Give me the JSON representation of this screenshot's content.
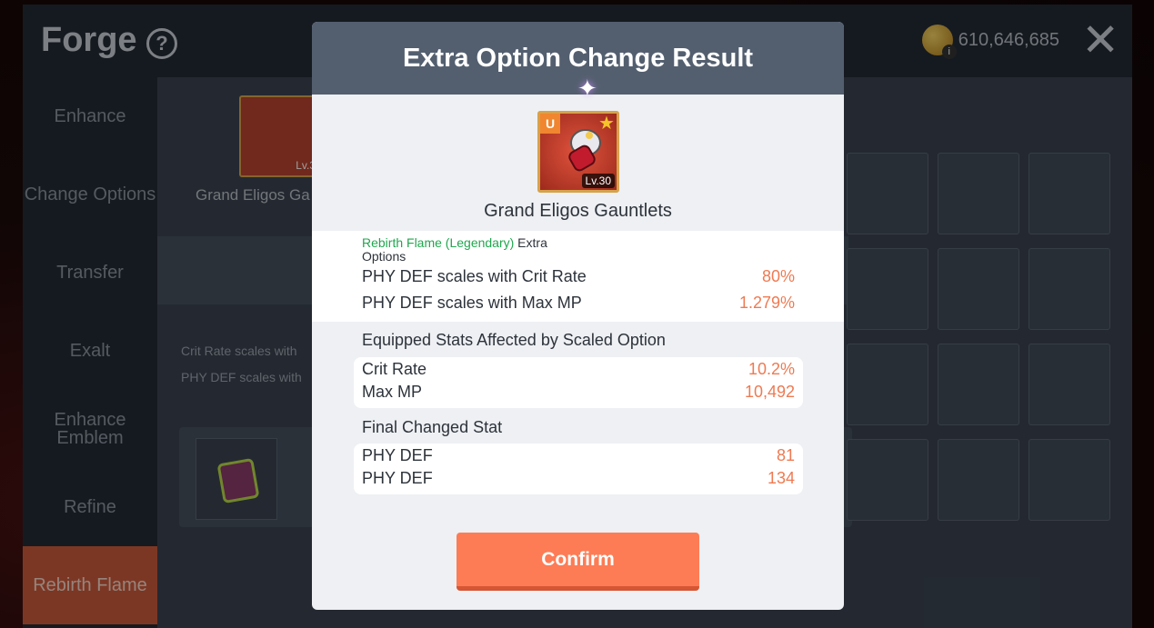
{
  "background": {
    "title": "Forge",
    "currency_amount": "610,646,685",
    "sidebar": [
      {
        "label": "Enhance"
      },
      {
        "label": "Change Options"
      },
      {
        "label": "Transfer"
      },
      {
        "label": "Exalt"
      },
      {
        "label": "Enhance Emblem"
      },
      {
        "label": "Refine"
      },
      {
        "label": "Rebirth Flame"
      }
    ],
    "item_name": "Grand Eligos Ga",
    "item_level": "Lv.3",
    "option_line_1": "Crit Rate scales with",
    "option_line_2": "PHY DEF scales with"
  },
  "modal": {
    "title": "Extra Option Change Result",
    "item": {
      "rarity": "U",
      "level": "Lv.30",
      "name": "Grand Eligos Gauntlets"
    },
    "options_source_highlight": "Rebirth Flame (Legendary)",
    "options_source_rest": " Extra Options",
    "options": [
      {
        "label": "PHY DEF scales with Crit Rate",
        "value": "80%"
      },
      {
        "label": "PHY DEF scales with Max MP",
        "value": "1.279%"
      }
    ],
    "equipped_label": "Equipped Stats Affected by Scaled Option",
    "equipped_stats": [
      {
        "label": "Crit Rate",
        "value": "10.2%"
      },
      {
        "label": "Max MP",
        "value": "10,492"
      }
    ],
    "final_label": "Final Changed Stat",
    "final_stats": [
      {
        "label": "PHY DEF",
        "value": "81"
      },
      {
        "label": "PHY DEF",
        "value": "134"
      }
    ],
    "confirm_label": "Confirm"
  },
  "colors": {
    "accent": "#fd7c55",
    "value_text": "#ef7a52",
    "legendary_green": "#21a64f",
    "header_bg": "#535f6f"
  }
}
